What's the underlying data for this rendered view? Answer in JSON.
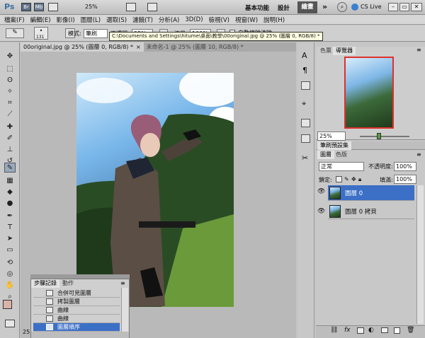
{
  "app": {
    "logo": "Ps",
    "zoom": "25%",
    "workspace": "基本功能",
    "design": "設計",
    "paint": "繪畫",
    "cslive": "CS Live"
  },
  "menu": [
    "檔案(F)",
    "編輯(E)",
    "影像(I)",
    "圖層(L)",
    "選取(S)",
    "濾鏡(T)",
    "分析(A)",
    "3D(D)",
    "檢視(V)",
    "視窗(W)",
    "說明(H)"
  ],
  "options": {
    "brush_size": "131",
    "mode_label": "模式:",
    "mode_value": "筆刷",
    "opacity_label": "不透明:",
    "opacity_value": "25%",
    "flow_label": "流量:",
    "flow_value": "100%",
    "auto_erase": "自動擦除清除"
  },
  "tooltip": "C:\\Documents and Settings\\hitume\\桌面\\教學\\00original.jpg @ 25% (圖層 0, RGB/8) *",
  "tabs": [
    {
      "label": "00original.jpg @ 25% (圖層 0, RGB/8) *"
    },
    {
      "label": "未命名-1 @ 25% (圖層 10, RGB/8) *"
    }
  ],
  "navigator": {
    "tab_color": "色票",
    "tab_nav": "導覽器",
    "zoom": "25%"
  },
  "brush_presets": {
    "title": "筆刷預設集"
  },
  "layers": {
    "tab_layers": "圖層",
    "tab_channels": "色版",
    "blend": "正常",
    "opacity_label": "不透明度:",
    "opacity_value": "100%",
    "lock_label": "鎖定:",
    "fill_label": "填滿:",
    "fill_value": "100%",
    "items": [
      {
        "name": "圖層 0"
      },
      {
        "name": "圖層 0 拷貝"
      }
    ]
  },
  "history": {
    "tab_history": "步驟記錄",
    "tab_actions": "動作",
    "items": [
      {
        "label": "合併可見圖層"
      },
      {
        "label": "拷製圖層"
      },
      {
        "label": "曲線"
      },
      {
        "label": "曲線"
      },
      {
        "label": "圖層順序"
      }
    ]
  },
  "status": {
    "zoom": "25"
  }
}
